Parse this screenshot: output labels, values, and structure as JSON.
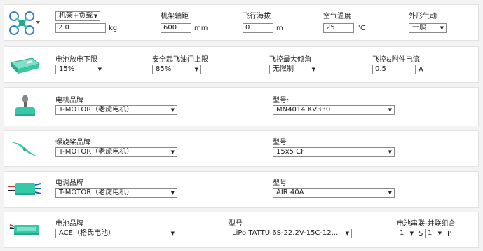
{
  "frame": {
    "type_select": "机架+负载",
    "wheelbase_label": "机架轴距",
    "altitude_label": "飞行海拔",
    "temperature_label": "空气温度",
    "shape_label": "外形气动",
    "weight_value": "2.0",
    "weight_unit": "kg",
    "wheelbase_value": "600",
    "wheelbase_unit": "mm",
    "altitude_value": "0",
    "altitude_unit": "m",
    "temperature_value": "25",
    "temperature_unit": "°C",
    "shape_select": "一般"
  },
  "battery_limits": {
    "discharge_label": "电池放电下限",
    "discharge_select": "15%",
    "throttle_label": "安全起飞油门上限",
    "throttle_select": "85%",
    "tilt_label": "飞控最大倾角",
    "tilt_select": "无限制",
    "current_label": "飞控&附件电流",
    "current_value": "0.5",
    "current_unit": "A"
  },
  "motor": {
    "brand_label": "电机品牌",
    "brand_select": "T-MOTOR（老虎电机）",
    "model_label": "型号:",
    "model_select": "MN4014 KV330"
  },
  "propeller": {
    "brand_label": "螺旋桨品牌",
    "brand_select": "T-MOTOR（老虎电机）",
    "model_label": "型号",
    "model_select": "15x5 CF"
  },
  "esc": {
    "brand_label": "电调品牌",
    "brand_select": "T-MOTOR（老虎电机）",
    "model_label": "型号",
    "model_select": "AIR 40A"
  },
  "battery": {
    "brand_label": "电池品牌",
    "brand_select": "ACE（格氏电池）",
    "model_label": "型号",
    "model_select": "LiPo TATTU 6S-22.2V-15C-12...",
    "config_label": "电池串联-并联组合",
    "series_select": "1",
    "series_unit": "S",
    "parallel_select": "1",
    "parallel_unit": "P"
  },
  "colors": {
    "accent_teal": "#34c9a8",
    "panel_border": "#e2e2e2"
  }
}
